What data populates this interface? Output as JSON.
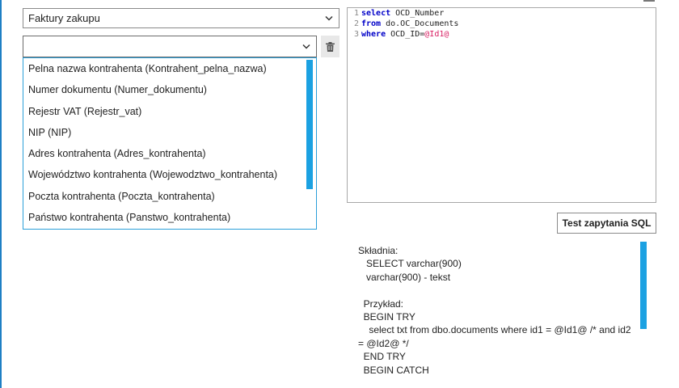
{
  "doc_type_select": {
    "value": "Faktury zakupu"
  },
  "field_select": {
    "value": ""
  },
  "dropdown": {
    "items": [
      "Pelna nazwa kontrahenta (Kontrahent_pelna_nazwa)",
      "Numer dokumentu (Numer_dokumentu)",
      "Rejestr VAT (Rejestr_vat)",
      "NIP (NIP)",
      "Adres kontrahenta (Adres_kontrahenta)",
      "Województwo kontrahenta (Wojewodztwo_kontrahenta)",
      "Poczta kontrahenta (Poczta_kontrahenta)",
      "Państwo kontrahenta (Panstwo_kontrahenta)"
    ]
  },
  "editor": {
    "lines": [
      {
        "num": "1",
        "keyword": "select",
        "text": " OCD_Number",
        "param": ""
      },
      {
        "num": "2",
        "keyword": "from",
        "text": " do.OC_Documents",
        "param": ""
      },
      {
        "num": "3",
        "keyword": "where",
        "text": " OCD_ID=",
        "param": "@Id1@"
      }
    ]
  },
  "test_button": {
    "label": "Test zapytania SQL"
  },
  "help": {
    "lines": [
      "Składnia:",
      "   SELECT varchar(900)",
      "   varchar(900) - tekst",
      "",
      "  Przykład:",
      "  BEGIN TRY",
      "    select txt from dbo.documents where id1 = @Id1@ /* and id2",
      "= @Id2@ */",
      "  END TRY",
      "  BEGIN CATCH"
    ]
  },
  "icons": {
    "delete": "trash-icon",
    "chevron": "chevron-down-icon"
  },
  "colors": {
    "accent": "#1ba1e2",
    "keyword": "#0000c8",
    "parameter": "#d81b60"
  }
}
